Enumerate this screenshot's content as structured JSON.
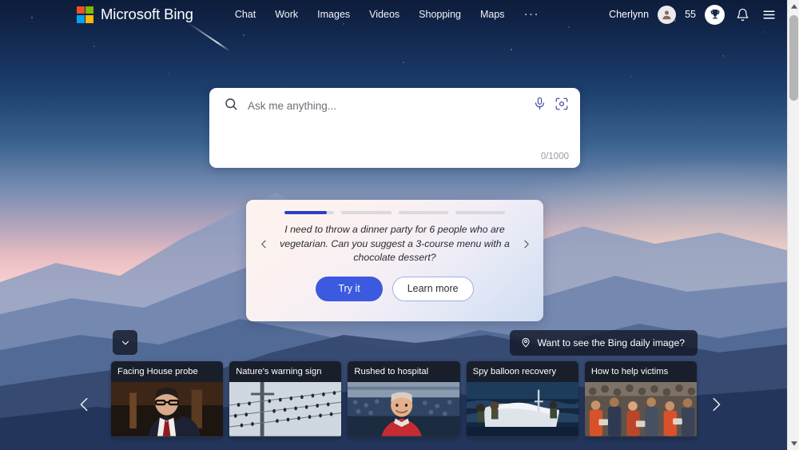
{
  "header": {
    "brand": "Microsoft Bing",
    "logo_icon": "microsoft-logo-icon",
    "logo_colors": [
      "#f25022",
      "#7fba00",
      "#00a4ef",
      "#ffb900"
    ],
    "nav": [
      {
        "label": "Chat"
      },
      {
        "label": "Work"
      },
      {
        "label": "Images"
      },
      {
        "label": "Videos"
      },
      {
        "label": "Shopping"
      },
      {
        "label": "Maps"
      }
    ],
    "more_label": "···",
    "user_name": "Cherlynn",
    "avatar_icon": "person-avatar-icon",
    "points": "55",
    "rewards_icon": "trophy-icon",
    "notifications_icon": "bell-icon",
    "menu_icon": "hamburger-menu-icon"
  },
  "search": {
    "placeholder": "Ask me anything...",
    "value": "",
    "counter": "0/1000",
    "search_icon": "search-icon",
    "mic_icon": "microphone-icon",
    "camera_icon": "visual-search-camera-icon"
  },
  "suggestion": {
    "prompt": "I need to throw a dinner party for 6 people who are vegetarian. Can you suggest a 3-course menu with a chocolate dessert?",
    "try_label": "Try it",
    "learn_label": "Learn more",
    "prev_icon": "chevron-left-icon",
    "next_icon": "chevron-right-icon",
    "progress": [
      85,
      0,
      0,
      0
    ],
    "accent_color": "#2a3fc4",
    "button_color": "#3b5ae0"
  },
  "daily_image": {
    "label": "Want to see the Bing daily image?",
    "icon": "location-pin-icon"
  },
  "collapse": {
    "icon": "chevron-down-icon"
  },
  "carousel": {
    "prev_icon": "chevron-left-icon",
    "next_icon": "chevron-right-icon",
    "cards": [
      {
        "title": "Facing House probe",
        "image": "man-in-suit-with-glasses-at-hearing"
      },
      {
        "title": "Nature's warning sign",
        "image": "birds-on-power-lines"
      },
      {
        "title": "Rushed to hospital",
        "image": "man-in-red-shirt-at-stadium"
      },
      {
        "title": "Spy balloon recovery",
        "image": "navy-crew-recovering-debris-at-sea"
      },
      {
        "title": "How to help victims",
        "image": "crowd-of-people-receiving-aid"
      }
    ]
  },
  "scrollbar": {
    "up_icon": "scroll-up-arrow-icon",
    "down_icon": "scroll-down-arrow-icon"
  }
}
